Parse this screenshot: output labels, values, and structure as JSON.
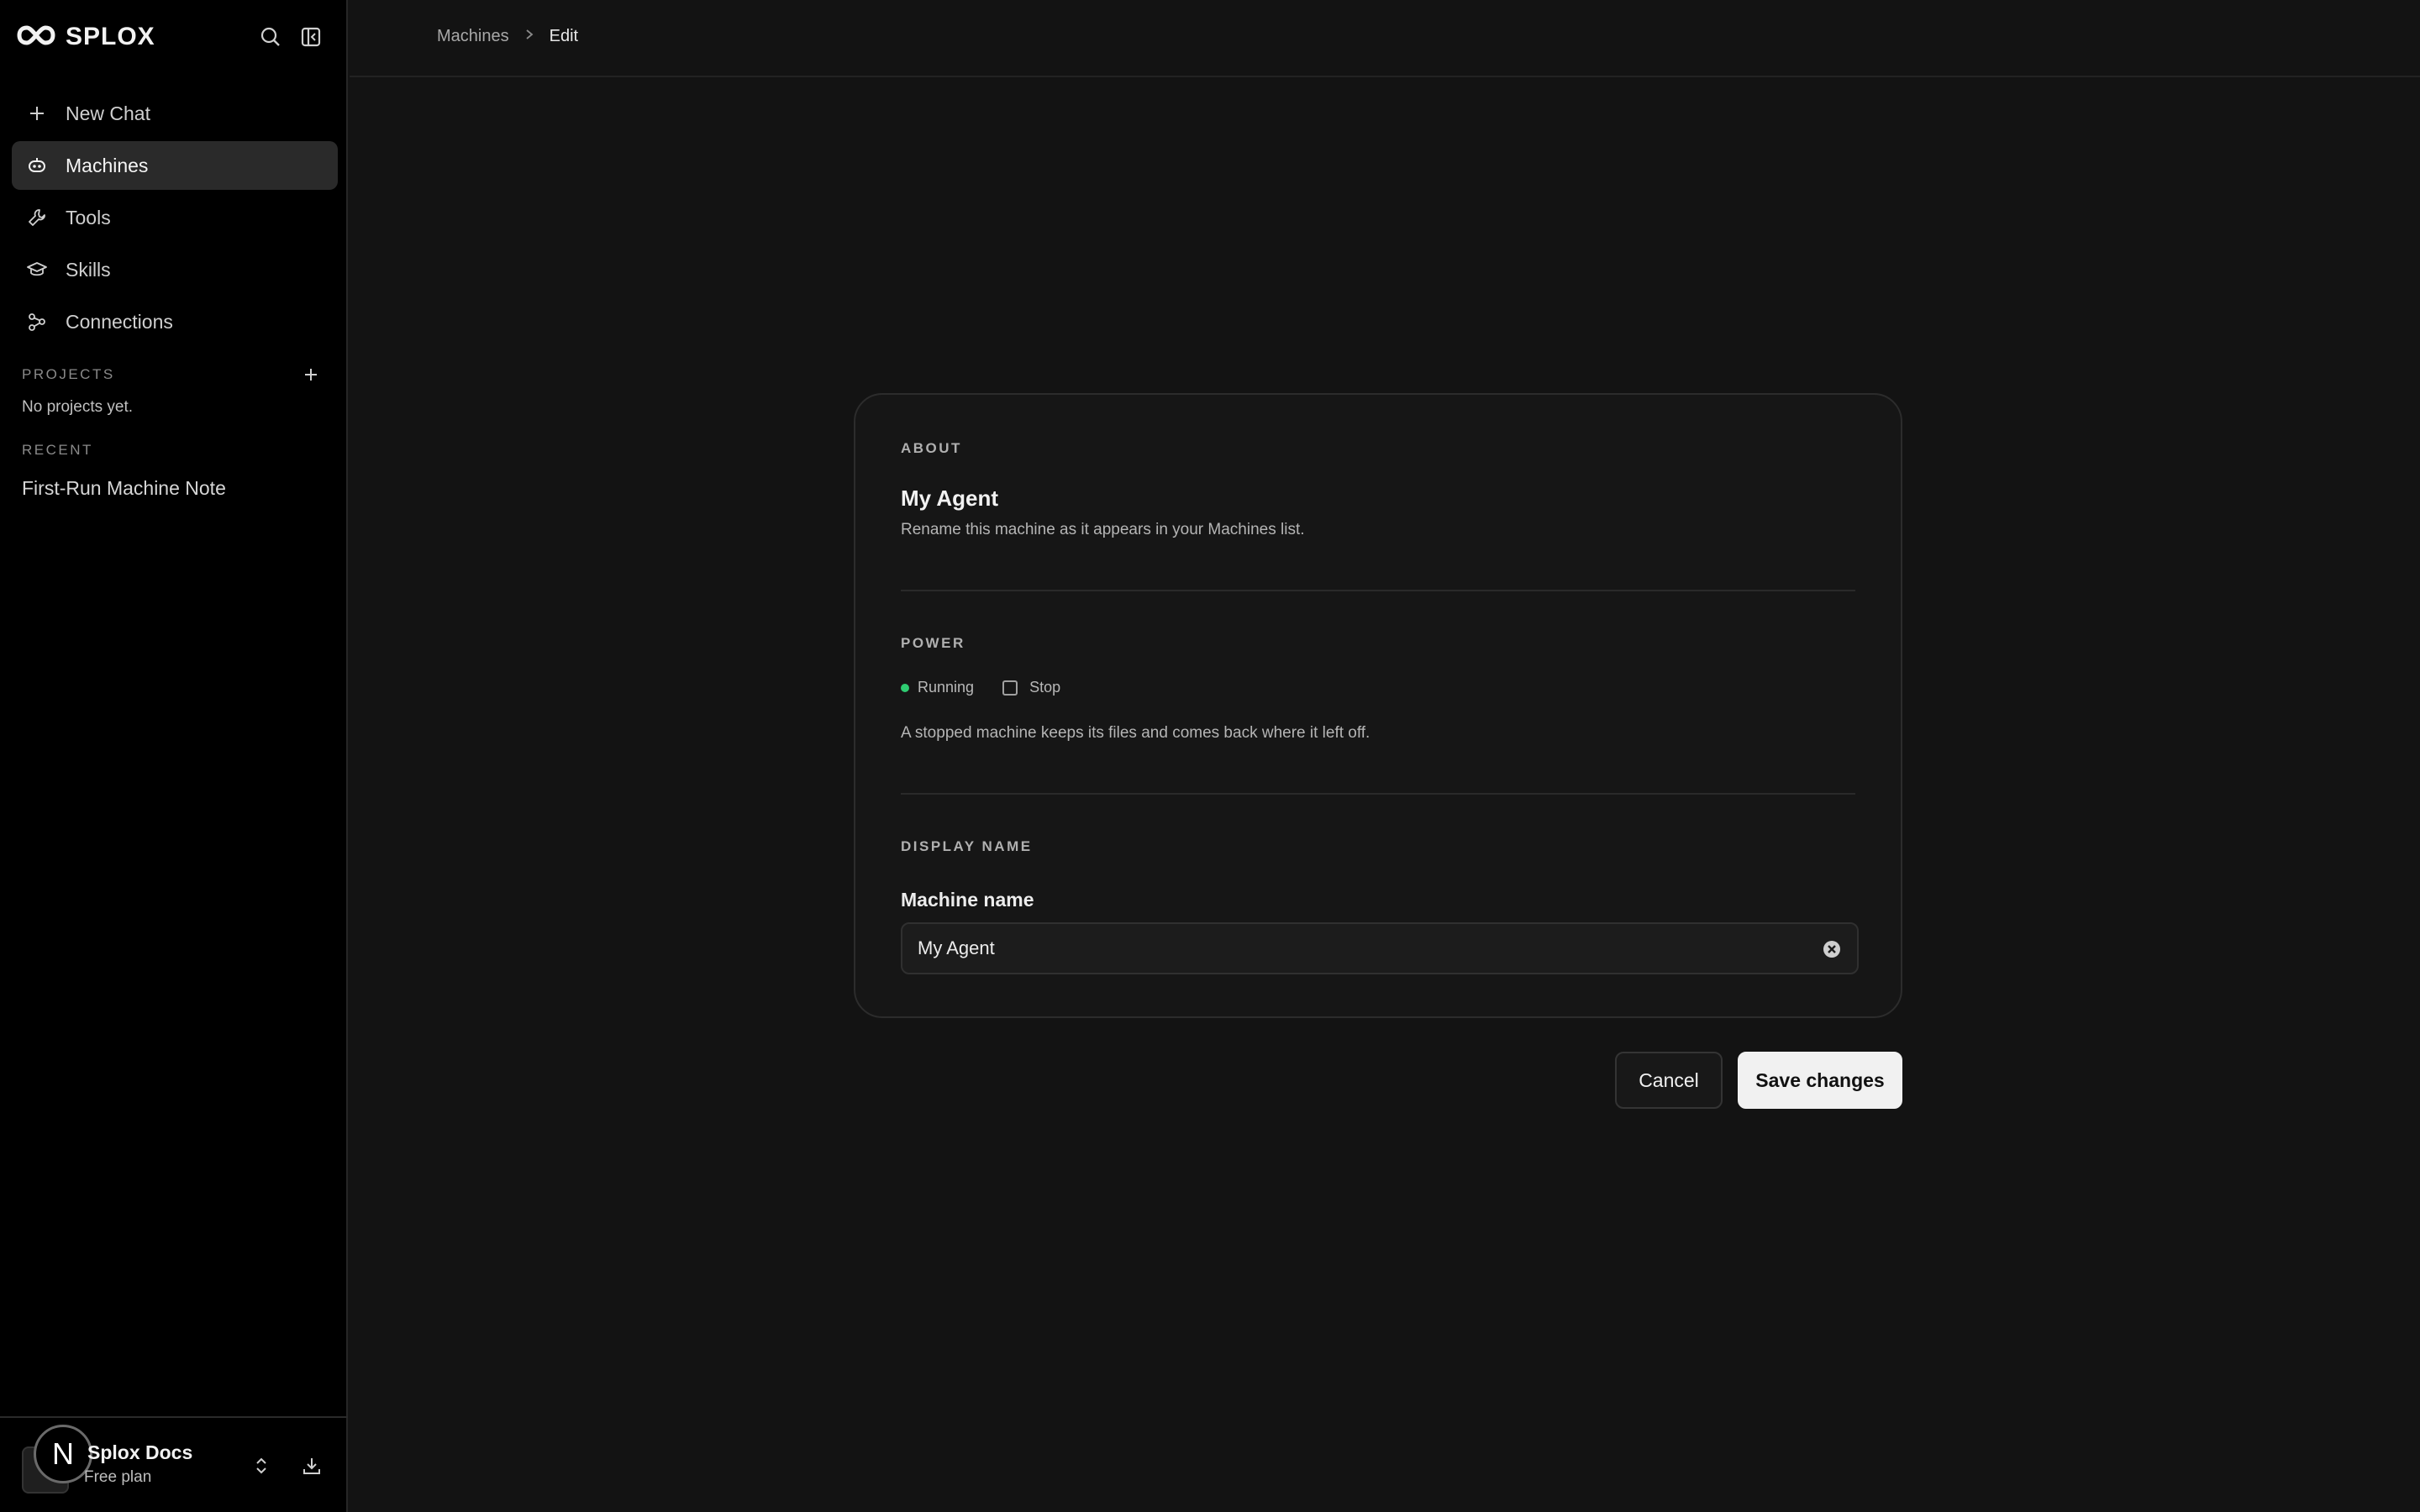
{
  "brand": {
    "name": "SPLOX"
  },
  "sidebar": {
    "items": [
      {
        "label": "New Chat",
        "icon": "plus-icon"
      },
      {
        "label": "Machines",
        "icon": "robot-icon",
        "active": true
      },
      {
        "label": "Tools",
        "icon": "wrench-icon"
      },
      {
        "label": "Skills",
        "icon": "graduation-cap-icon"
      },
      {
        "label": "Connections",
        "icon": "connections-icon"
      }
    ],
    "projects_label": "PROJECTS",
    "projects_empty": "No projects yet.",
    "recent_label": "RECENT",
    "recent_items": [
      "First-Run Machine Note"
    ],
    "footer": {
      "badge": "N",
      "workspace_name": "Splox Docs",
      "plan": "Free plan"
    }
  },
  "breadcrumb": {
    "parent": "Machines",
    "current": "Edit"
  },
  "about": {
    "section_label": "ABOUT",
    "title": "My Agent",
    "description": "Rename this machine as it appears in your Machines list."
  },
  "power": {
    "section_label": "POWER",
    "status": "Running",
    "status_color": "#2ecc71",
    "stop_label": "Stop",
    "description": "A stopped machine keeps its files and comes back where it left off."
  },
  "display_name": {
    "section_label": "DISPLAY NAME",
    "field_label": "Machine name",
    "value": "My Agent"
  },
  "actions": {
    "cancel": "Cancel",
    "save": "Save changes"
  }
}
